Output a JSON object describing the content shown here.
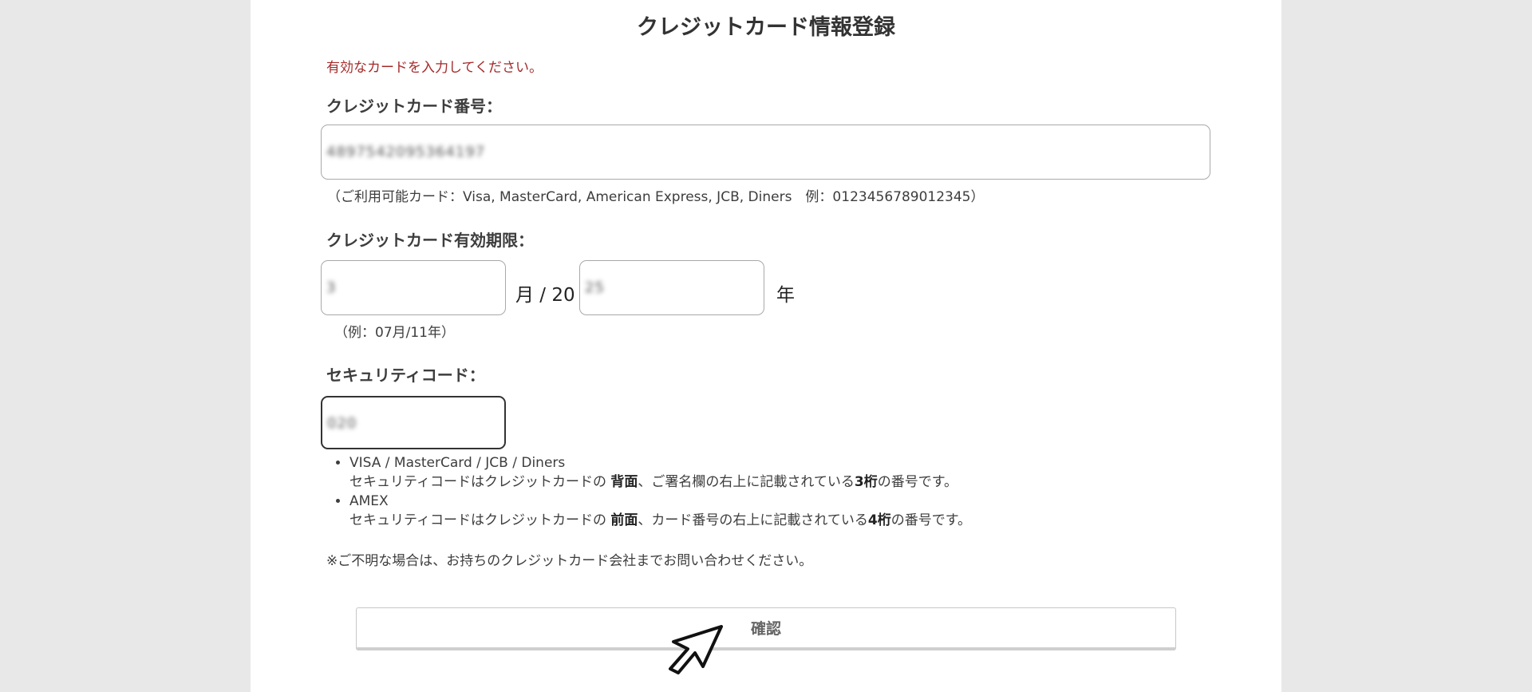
{
  "form": {
    "title": "クレジットカード情報登録",
    "error_message": "有効なカードを入力してください。",
    "card_number": {
      "label": "クレジットカード番号：",
      "value": "4897542095364197",
      "note": "（ご利用可能カード：Visa, MasterCard, American Express, JCB, Diners　例：0123456789012345）"
    },
    "expiry": {
      "label": "クレジットカード有効期限：",
      "month_value": "3",
      "month_suffix": "月 / 20",
      "year_value": "25",
      "year_suffix": "年",
      "note": "（例：07月/11年）"
    },
    "security_code": {
      "label": "セキュリティコード：",
      "value": "020",
      "help": [
        {
          "brand": "VISA / MasterCard / JCB / Diners",
          "text_pre": "セキュリティコードはクレジットカードの ",
          "side": "背面",
          "text_mid": "、ご署名欄の右上に記載されている",
          "digits": "3桁",
          "text_post": "の番号です。"
        },
        {
          "brand": "AMEX",
          "text_pre": "セキュリティコードはクレジットカードの ",
          "side": "前面",
          "text_mid": "、カード番号の右上に記載されている",
          "digits": "4桁",
          "text_post": "の番号です。"
        }
      ],
      "footnote": "※ご不明な場合は、お持ちのクレジットカード会社までお問い合わせください。"
    },
    "confirm_label": "確認"
  },
  "icons": {
    "cursor": "arrow-cursor-icon"
  }
}
